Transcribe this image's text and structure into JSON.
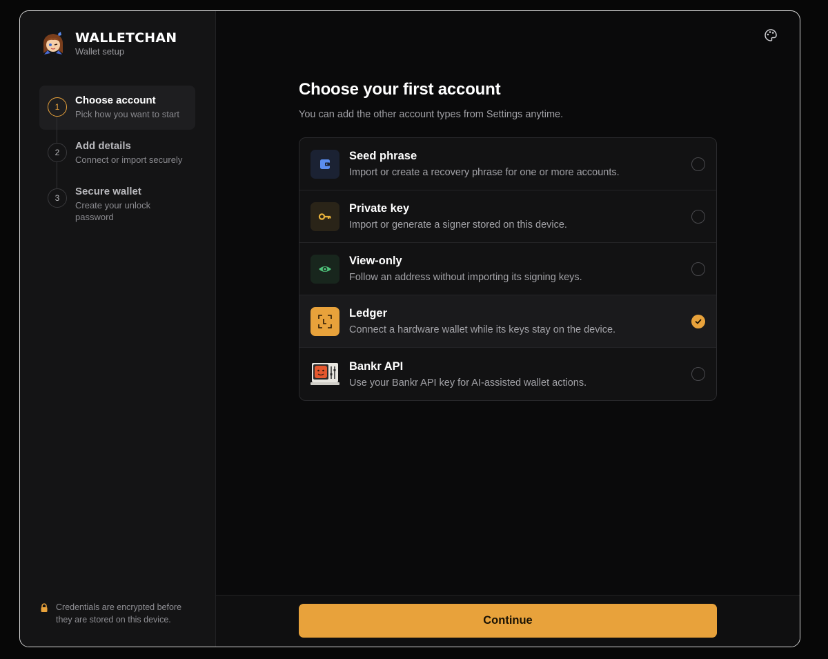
{
  "brand": {
    "name": "WALLETCHAN",
    "subtitle": "Wallet setup"
  },
  "steps": [
    {
      "number": "1",
      "title": "Choose account",
      "desc": "Pick how you want to start",
      "active": true
    },
    {
      "number": "2",
      "title": "Add details",
      "desc": "Connect or import securely",
      "active": false
    },
    {
      "number": "3",
      "title": "Secure wallet",
      "desc": "Create your unlock password",
      "active": false
    }
  ],
  "security_note": "Credentials are encrypted before they are stored on this device.",
  "main": {
    "title": "Choose your first account",
    "subtitle": "You can add the other account types from Settings anytime."
  },
  "options": [
    {
      "icon": "wallet-icon",
      "title": "Seed phrase",
      "desc": "Import or create a recovery phrase for one or more accounts.",
      "selected": false
    },
    {
      "icon": "key-icon",
      "title": "Private key",
      "desc": "Import or generate a signer stored on this device.",
      "selected": false
    },
    {
      "icon": "eye-icon",
      "title": "View-only",
      "desc": "Follow an address without importing its signing keys.",
      "selected": false
    },
    {
      "icon": "ledger-icon",
      "title": "Ledger",
      "desc": "Connect a hardware wallet while its keys stay on the device.",
      "selected": true
    },
    {
      "icon": "bankr-robot-icon",
      "title": "Bankr API",
      "desc": "Use your Bankr API key for AI-assisted wallet actions.",
      "selected": false
    }
  ],
  "continue_label": "Continue",
  "colors": {
    "accent": "#e8a23b",
    "seed": "#5b8def",
    "key": "#e8b23b",
    "eye": "#4ec27a"
  }
}
